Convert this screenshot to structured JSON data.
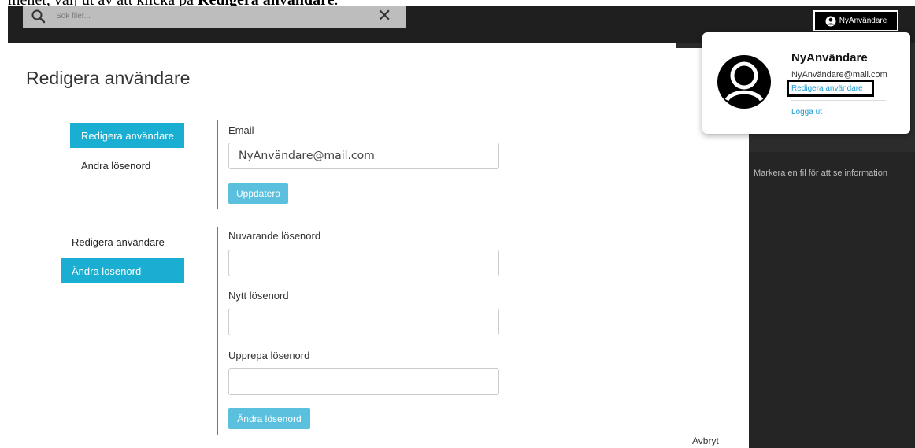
{
  "doc": {
    "text_prefix": "menet, välj ut av att klicka på ",
    "text_bold": "Redigera användare",
    "text_suffix": "."
  },
  "search": {
    "placeholder": "Sök filer...",
    "clear": "✕"
  },
  "user_button": {
    "label": "NyAnvändare"
  },
  "popup": {
    "name": "NyAnvändare",
    "email": "NyAnvändare@mail.com",
    "edit_link": "Redigera användare",
    "logout_link": "Logga ut"
  },
  "right_panel": {
    "info": "Markera en fil för att se information"
  },
  "page": {
    "title": "Redigera användare"
  },
  "section_email": {
    "side_items": [
      "Redigera användare",
      "Ändra lösenord"
    ],
    "active_index": 0,
    "email_label": "Email",
    "email_value": "NyAnvändare@mail.com",
    "update_button": "Uppdatera"
  },
  "section_password": {
    "side_items": [
      "Redigera användare",
      "Ändra lösenord"
    ],
    "active_index": 1,
    "current_label": "Nuvarande lösenord",
    "new_label": "Nytt lösenord",
    "repeat_label": "Upprepa lösenord",
    "change_button": "Ändra lösenord"
  },
  "footer": {
    "cancel": "Avbryt"
  },
  "colors": {
    "accent": "#1aaed3",
    "button": "#5bc0de",
    "link": "#1a9bd7",
    "dark": "#252525"
  }
}
